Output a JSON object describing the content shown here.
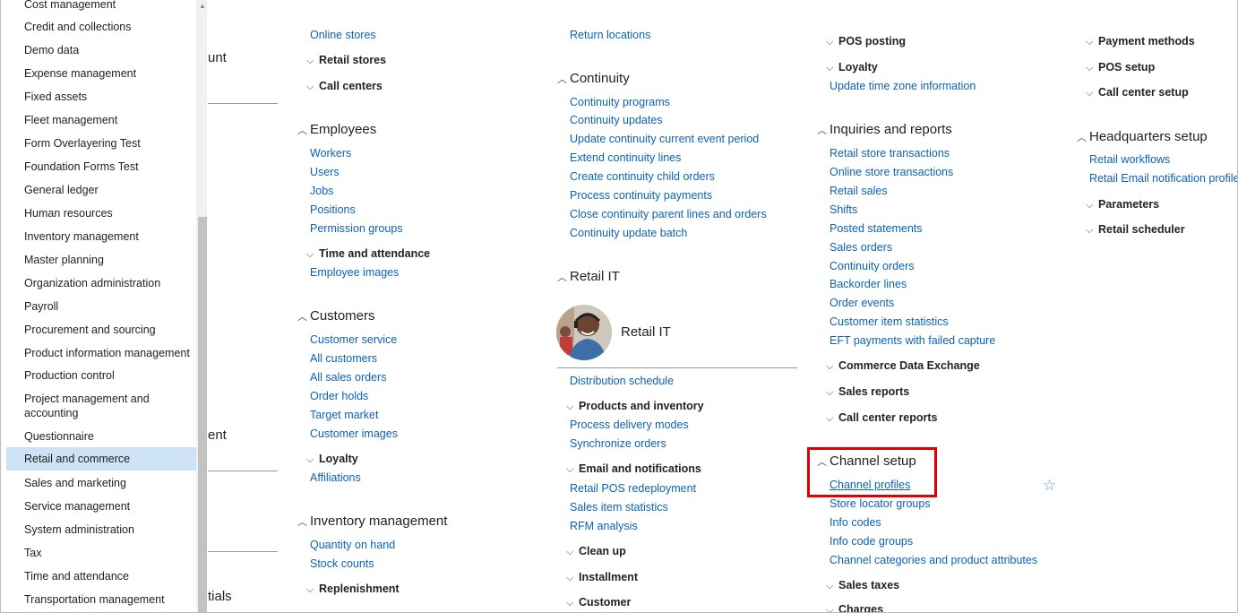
{
  "sidebar": {
    "items": [
      "Cost management",
      "Credit and collections",
      "Demo data",
      "Expense management",
      "Fixed assets",
      "Fleet management",
      "Form Overlayering Test",
      "Foundation Forms Test",
      "General ledger",
      "Human resources",
      "Inventory management",
      "Master planning",
      "Organization administration",
      "Payroll",
      "Procurement and sourcing",
      "Product information management",
      "Production control",
      "Project management and",
      "accounting",
      "Questionnaire",
      "Retail and commerce",
      "Sales and marketing",
      "Service management",
      "System administration",
      "Tax",
      "Time and attendance",
      "Transportation management"
    ],
    "selected": "Retail and commerce"
  },
  "workspace_fragments": [
    "unt",
    "ent",
    "tials"
  ],
  "col1": {
    "links_top": [
      "Online stores"
    ],
    "group_retail_stores": "Retail stores",
    "group_call_centers": "Call centers",
    "employees": {
      "title": "Employees",
      "links": [
        "Workers",
        "Users",
        "Jobs",
        "Positions",
        "Permission groups"
      ]
    },
    "group_time_attendance": "Time and attendance",
    "employee_images": "Employee images",
    "customers": {
      "title": "Customers",
      "links": [
        "Customer service",
        "All customers",
        "All sales orders",
        "Order holds",
        "Target market",
        "Customer images"
      ]
    },
    "group_loyalty": "Loyalty",
    "affiliations": "Affiliations",
    "inventory": {
      "title": "Inventory management",
      "links": [
        "Quantity on hand",
        "Stock counts"
      ]
    },
    "group_replenishment": "Replenishment"
  },
  "col2": {
    "return_locations": "Return locations",
    "continuity": {
      "title": "Continuity",
      "links": [
        "Continuity programs",
        "Continuity updates",
        "Update continuity current event period",
        "Extend continuity lines",
        "Create continuity child orders",
        "Process continuity payments",
        "Close continuity parent lines and orders",
        "Continuity update batch"
      ]
    },
    "retail_it": {
      "title": "Retail IT",
      "avatar_label": "Retail IT"
    },
    "distribution_schedule": "Distribution schedule",
    "group_products_inventory": "Products and inventory",
    "products_links": [
      "Process delivery modes",
      "Synchronize orders"
    ],
    "group_email_notifications": "Email and notifications",
    "email_links": [
      "Retail POS redeployment",
      "Sales item statistics",
      "RFM analysis"
    ],
    "group_clean_up": "Clean up",
    "group_installment": "Installment",
    "group_customer": "Customer"
  },
  "col3": {
    "group_pos_posting": "POS posting",
    "group_loyalty": "Loyalty",
    "update_time_zone": "Update time zone information",
    "inquiries": {
      "title": "Inquiries and reports",
      "links": [
        "Retail store transactions",
        "Online store transactions",
        "Retail sales",
        "Shifts",
        "Posted statements",
        "Sales orders",
        "Continuity orders",
        "Backorder lines",
        "Order events",
        "Customer item statistics",
        "EFT payments with failed capture"
      ]
    },
    "group_commerce_data_exchange": "Commerce Data Exchange",
    "group_sales_reports": "Sales reports",
    "group_call_center_reports": "Call center reports",
    "channel_setup": {
      "title": "Channel setup",
      "links": [
        "Channel profiles",
        "Store locator groups",
        "Info codes",
        "Info code groups",
        "Channel categories and product attributes"
      ]
    },
    "group_sales_taxes": "Sales taxes",
    "group_charges": "Charges"
  },
  "col4": {
    "group_payment_methods": "Payment methods",
    "group_pos_setup": "POS setup",
    "group_call_center_setup": "Call center setup",
    "headquarters": {
      "title": "Headquarters setup",
      "links": [
        "Retail workflows",
        "Retail Email notification profile"
      ]
    },
    "group_parameters": "Parameters",
    "group_retail_scheduler": "Retail scheduler"
  },
  "icons": {
    "expand": "chevron-down-icon",
    "collapse": "chevron-up-icon",
    "favorite": "star-icon"
  },
  "colors": {
    "link": "#0b62b6",
    "selected_bg": "#cde3f5",
    "highlight": "#e00000"
  }
}
